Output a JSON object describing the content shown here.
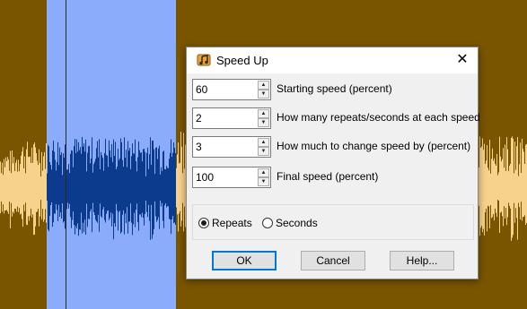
{
  "dialog": {
    "title": "Speed Up",
    "icon": "music-note-icon",
    "close_symbol": "✕"
  },
  "fields": [
    {
      "value": "60",
      "label": "Starting speed (percent)"
    },
    {
      "value": "2",
      "label": "How many repeats/seconds at each speed"
    },
    {
      "value": "3",
      "label": "How much to change speed by (percent)"
    },
    {
      "value": "100",
      "label": "Final speed (percent)"
    }
  ],
  "mode": {
    "options": [
      "Repeats",
      "Seconds"
    ],
    "selected": "Repeats"
  },
  "buttons": {
    "ok": "OK",
    "cancel": "Cancel",
    "help": "Help..."
  },
  "colors": {
    "track_background": "#7a5500",
    "selection": "#8aacfb",
    "waveform": "#f6d28c",
    "waveform_selected": "#0c3a8c",
    "focus_border": "#0078d7"
  }
}
